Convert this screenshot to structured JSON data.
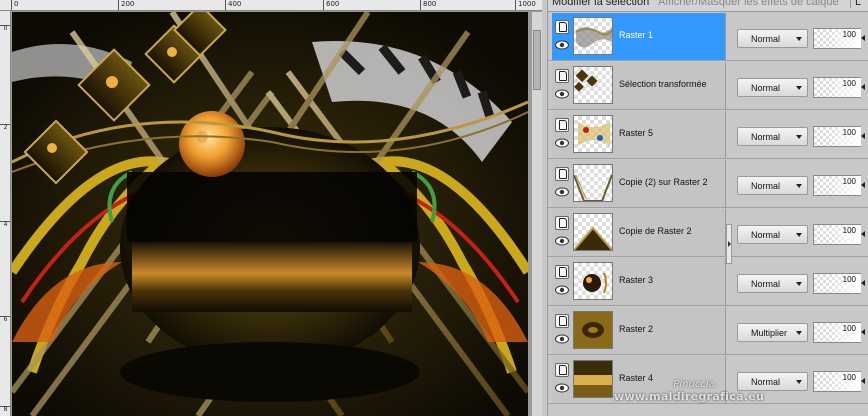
{
  "rulers": {
    "horizontal": [
      "0",
      "200",
      "400",
      "600",
      "800",
      "1000"
    ],
    "vertical": [
      "0",
      "2",
      "4",
      "6",
      "8"
    ]
  },
  "panel": {
    "tab_active": "Modifier la sélection",
    "tab_effects": "Afficher/Masquer les effets de calque",
    "tab_extra": "L"
  },
  "layers": [
    {
      "name": "Raster 1",
      "blend": "Normal",
      "opacity": "100",
      "selected": true,
      "thumb": "raster-1"
    },
    {
      "name": "Sélection transformée",
      "blend": "Normal",
      "opacity": "100",
      "selected": false,
      "thumb": "selection"
    },
    {
      "name": "Raster 5",
      "blend": "Normal",
      "opacity": "100",
      "selected": false,
      "thumb": "raster-5"
    },
    {
      "name": "Copie (2) sur Raster 2",
      "blend": "Normal",
      "opacity": "100",
      "selected": false,
      "thumb": "copy-2"
    },
    {
      "name": "Copie de Raster 2",
      "blend": "Normal",
      "opacity": "100",
      "selected": false,
      "thumb": "copy-raster-2"
    },
    {
      "name": "Raster 3",
      "blend": "Normal",
      "opacity": "100",
      "selected": false,
      "thumb": "raster-3"
    },
    {
      "name": "Raster 2",
      "blend": "Multiplier",
      "opacity": "100",
      "selected": false,
      "thumb": "raster-2"
    },
    {
      "name": "Raster 4",
      "blend": "Normal",
      "opacity": "100",
      "selected": false,
      "thumb": "raster-4"
    }
  ],
  "watermark": {
    "name": "Pinuccia",
    "url": "www.maldiregrafica.eu"
  },
  "colors": {
    "selection": "#3399ff",
    "panel_bg": "#c8c8c8",
    "canvas_bg": "#191407"
  }
}
